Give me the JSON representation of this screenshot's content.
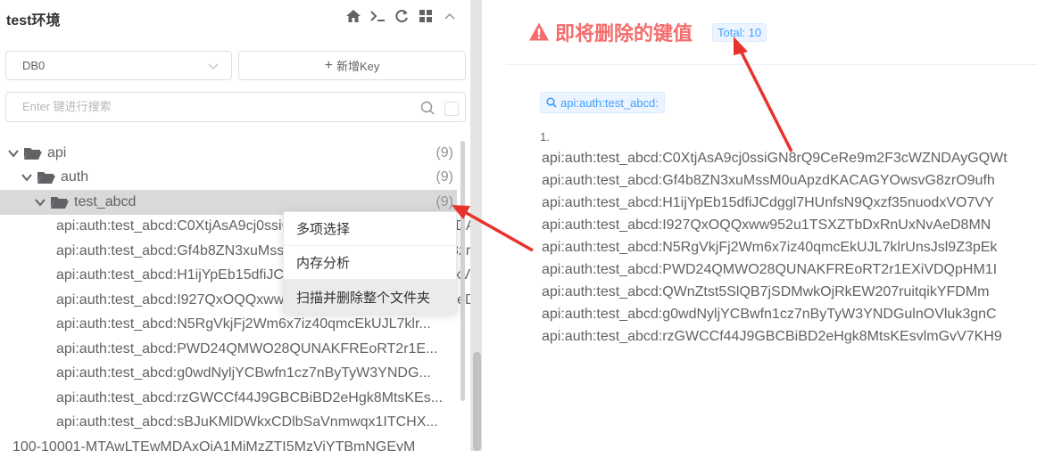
{
  "left": {
    "title": "test环境",
    "header_icons": [
      "home-icon",
      "terminal-icon",
      "refresh-icon",
      "grid-icon",
      "collapse-icon"
    ],
    "db_select": {
      "value": "DB0"
    },
    "new_key_label": "新增Key",
    "search": {
      "placeholder": "Enter 键进行搜索"
    },
    "tree": [
      {
        "label": "api",
        "count": "(9)",
        "level": 0,
        "type": "folder"
      },
      {
        "label": "auth",
        "count": "(9)",
        "level": 1,
        "type": "folder"
      },
      {
        "label": "test_abcd",
        "count": "(9)",
        "level": 2,
        "type": "folder",
        "selected": true
      },
      {
        "label": "api:auth:test_abcd:C0XtjAsA9cj0ssiGN8rQ9CeRe9m2F3cWZNDAyGQWt",
        "level": 3,
        "type": "key"
      },
      {
        "label": "api:auth:test_abcd:Gf4b8ZN3xuMssM0uApzdKACAGYOwsvG8zrO9ufh",
        "level": 3,
        "type": "key"
      },
      {
        "label": "api:auth:test_abcd:H1ijYpEb15dfiJCdggl7HUnfsN9Qxzf35nuodxVO7V",
        "level": 3,
        "type": "key"
      },
      {
        "label": "api:auth:test_abcd:I927QxOQQxww952u1TSXZTbDxRnUxNvAeD8MN",
        "level": 3,
        "type": "key"
      },
      {
        "label": "api:auth:test_abcd:N5RgVkjFj2Wm6x7iz40qmcEkUJL7klr...",
        "level": 3,
        "type": "key"
      },
      {
        "label": "api:auth:test_abcd:PWD24QMWO28QUNAKFREoRT2r1E...",
        "level": 3,
        "type": "key"
      },
      {
        "label": "api:auth:test_abcd:g0wdNyljYCBwfn1cz7nByTyW3YNDG...",
        "level": 3,
        "type": "key"
      },
      {
        "label": "api:auth:test_abcd:rzGWCCf44J9GBCBiBD2eHgk8MtsKEs...",
        "level": 3,
        "type": "key"
      },
      {
        "label": "api:auth:test_abcd:sBJuKMlDWkxCDlbSaVnmwqx1ITCHX...",
        "level": 3,
        "type": "key"
      },
      {
        "label": "100-10001-MTAwLTEwMDAxOjA1MjMzZTI5MzViYTBmNGEyM",
        "level": -1,
        "type": "key"
      }
    ],
    "context_menu": [
      "多项选择",
      "内存分析",
      "扫描并删除整个文件夹"
    ]
  },
  "right": {
    "title": "即将删除的键值",
    "total": "Total: 10",
    "search_tag": "api:auth:test_abcd:",
    "first_index": "1.",
    "keys": [
      "api:auth:test_abcd:C0XtjAsA9cj0ssiGN8rQ9CeRe9m2F3cWZNDAyGQWt",
      "api:auth:test_abcd:Gf4b8ZN3xuMssM0uApzdKACAGYOwsvG8zrO9ufh",
      "api:auth:test_abcd:H1ijYpEb15dfiJCdggl7HUnfsN9Qxzf35nuodxVO7VY",
      "api:auth:test_abcd:I927QxOQQxww952u1TSXZTbDxRnUxNvAeD8MN",
      "api:auth:test_abcd:N5RgVkjFj2Wm6x7iz40qmcEkUJL7klrUnsJsl9Z3pEk",
      "api:auth:test_abcd:PWD24QMWO28QUNAKFREoRT2r1EXiVDQpHM1I",
      "api:auth:test_abcd:QWnZtst5SlQB7jSDMwkOjRkEW207ruitqikYFDMm",
      "api:auth:test_abcd:g0wdNyljYCBwfn1cz7nByTyW3YNDGulnOVluk3gnC",
      "api:auth:test_abcd:rzGWCCf44J9GBCBiBD2eHgk8MtsKEsvlmGvV7KH9"
    ]
  },
  "colors": {
    "warning": "#f56c6c",
    "primary": "#409eff",
    "arrow": "#e8322c",
    "selected_row": "#d9d9d9"
  }
}
